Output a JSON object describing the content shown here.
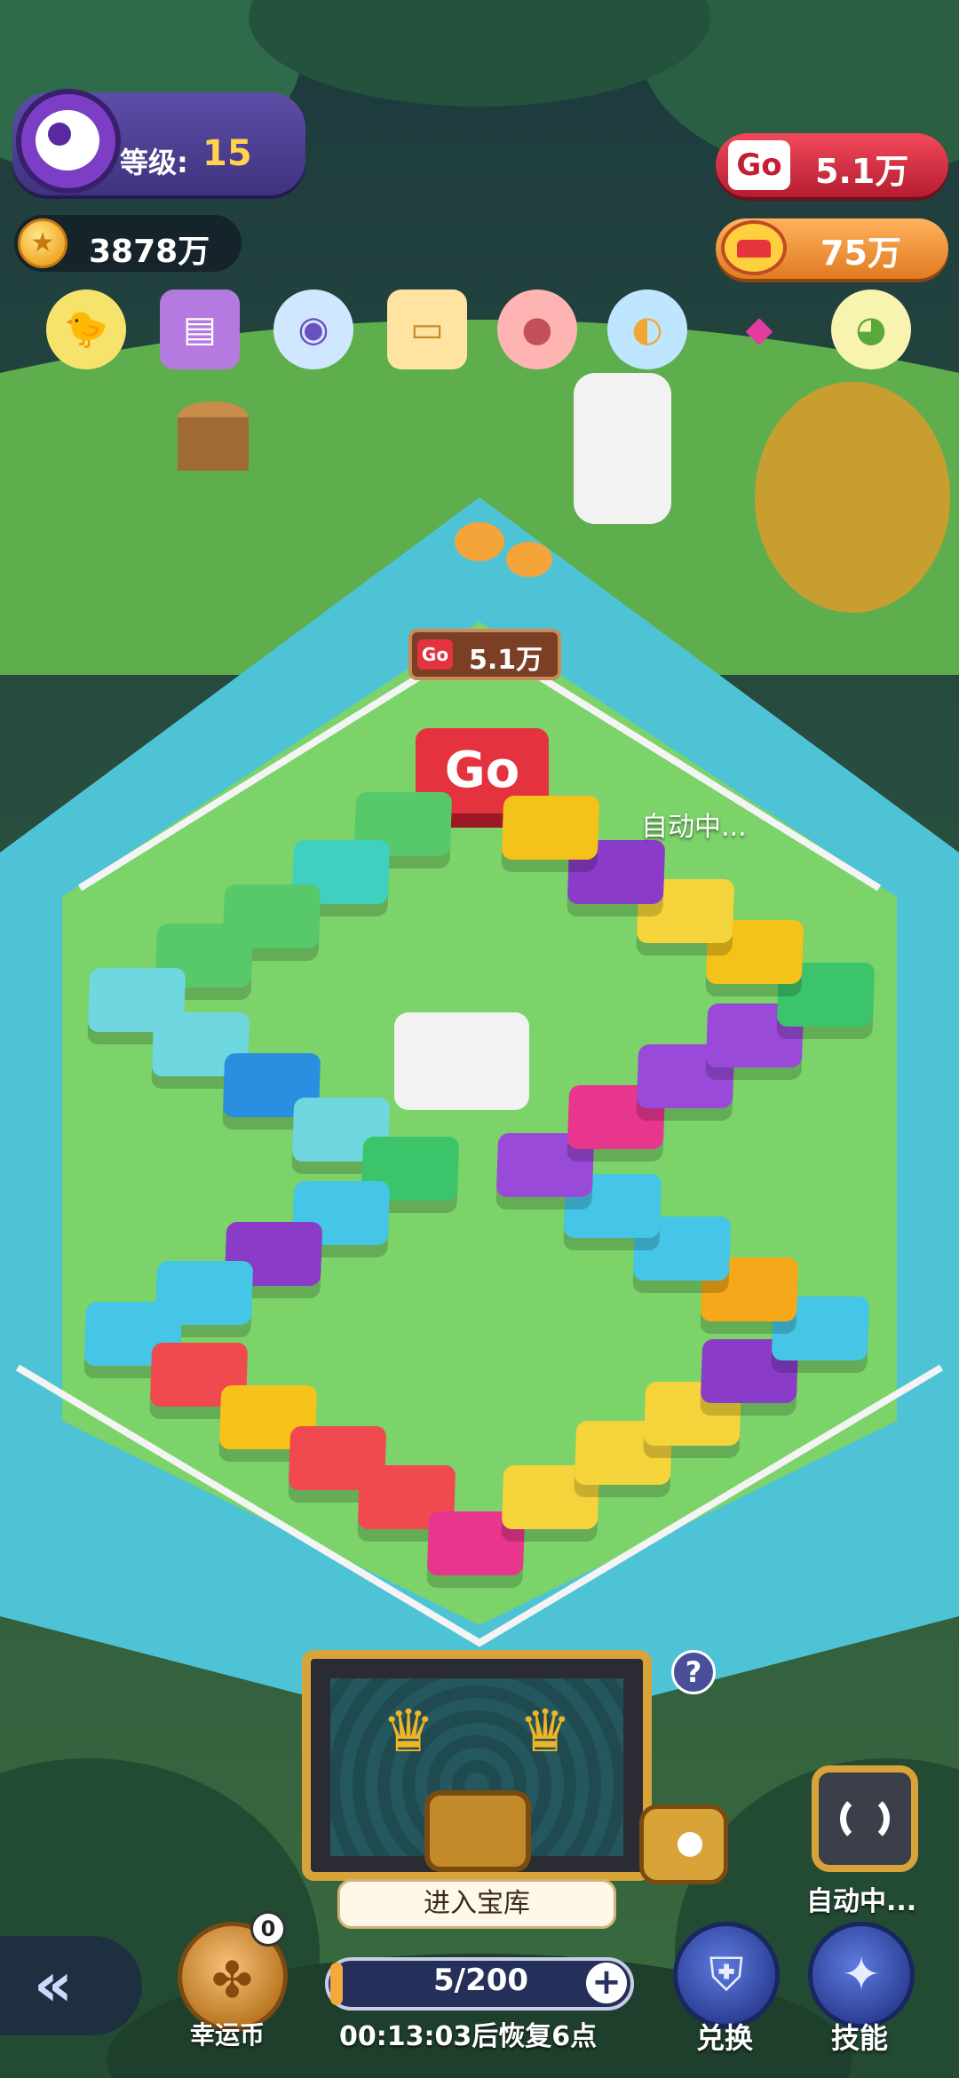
{
  "player": {
    "level_label": "等级:",
    "level_value": "15",
    "coins": "3878万"
  },
  "resources": {
    "go_badge": "Go",
    "go_amount": "5.1万",
    "crown_amount": "75万"
  },
  "collection_icons": [
    "green-bird-icon",
    "purple-book-icon",
    "owl-icon",
    "cake-icon",
    "pig-icon",
    "penguin-icon",
    "pink-gem-icon",
    "yellow-chick-icon"
  ],
  "board": {
    "start_tile_label": "Go",
    "sign_go_label": "Go",
    "sign_amount": "5.1万",
    "auto_status_float": "自动中..."
  },
  "vault": {
    "enter_button": "进入宝库",
    "help_glyph": "?",
    "crown_glyph": "♛"
  },
  "auto_button": {
    "label": "自动中..."
  },
  "bottom_bar": {
    "back_glyph": "«",
    "lucky_label": "幸运币",
    "lucky_badge": "0",
    "clover_glyph": "✤",
    "energy": "5/200",
    "energy_fraction": 0.025,
    "plus_glyph": "+",
    "recovery_timer": "00:13:03后恢复6点",
    "exchange_label": "兑换",
    "skill_label": "技能",
    "exchange_glyph": "⛨",
    "skill_glyph": "✦"
  },
  "colors": {
    "grass": "#7bd36a",
    "water": "#5fd6e8",
    "go_red": "#e4323f",
    "gold_frame": "#d8a43a"
  }
}
